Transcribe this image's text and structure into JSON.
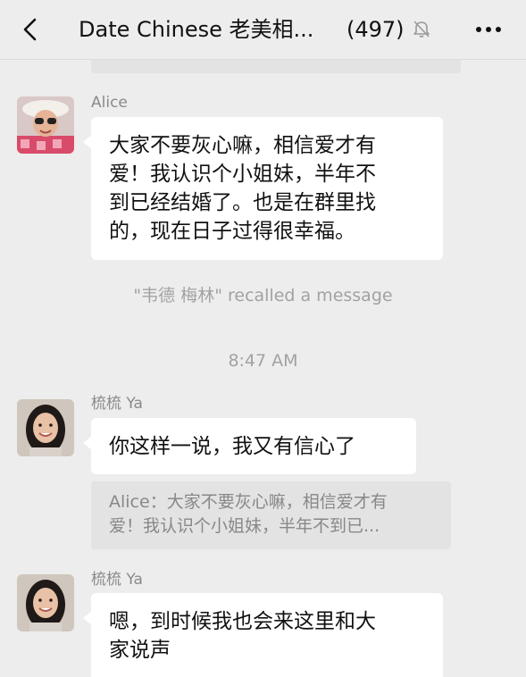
{
  "header": {
    "back_icon": "chevron-left-icon",
    "title": "Date Chinese 老美相...",
    "member_count": "(497)",
    "mute_icon": "bell-muted-icon",
    "more_icon": "ellipsis-icon"
  },
  "messages": [
    {
      "sender": "Alice",
      "text_lines": [
        "大家不要灰心嘛，相信爱才有",
        "爱！我认识个小姐妹，半年不",
        "到已经结婚了。也是在群里找",
        "的，现在日子过得很幸福。"
      ]
    },
    {
      "system": "\"韦德 梅林\" recalled a message"
    },
    {
      "timestamp": "8:47 AM"
    },
    {
      "sender": "梳梳 Ya",
      "text_lines": [
        "你这样一说，我又有信心了"
      ],
      "quote_lines": [
        "Alice：大家不要灰心嘛，相信爱才有",
        "爱！我认识个小姐妹，半年不到已..."
      ]
    },
    {
      "sender": "梳梳 Ya",
      "text_lines": [
        "嗯，到时候我也会来这里和大",
        "家说声"
      ]
    }
  ]
}
